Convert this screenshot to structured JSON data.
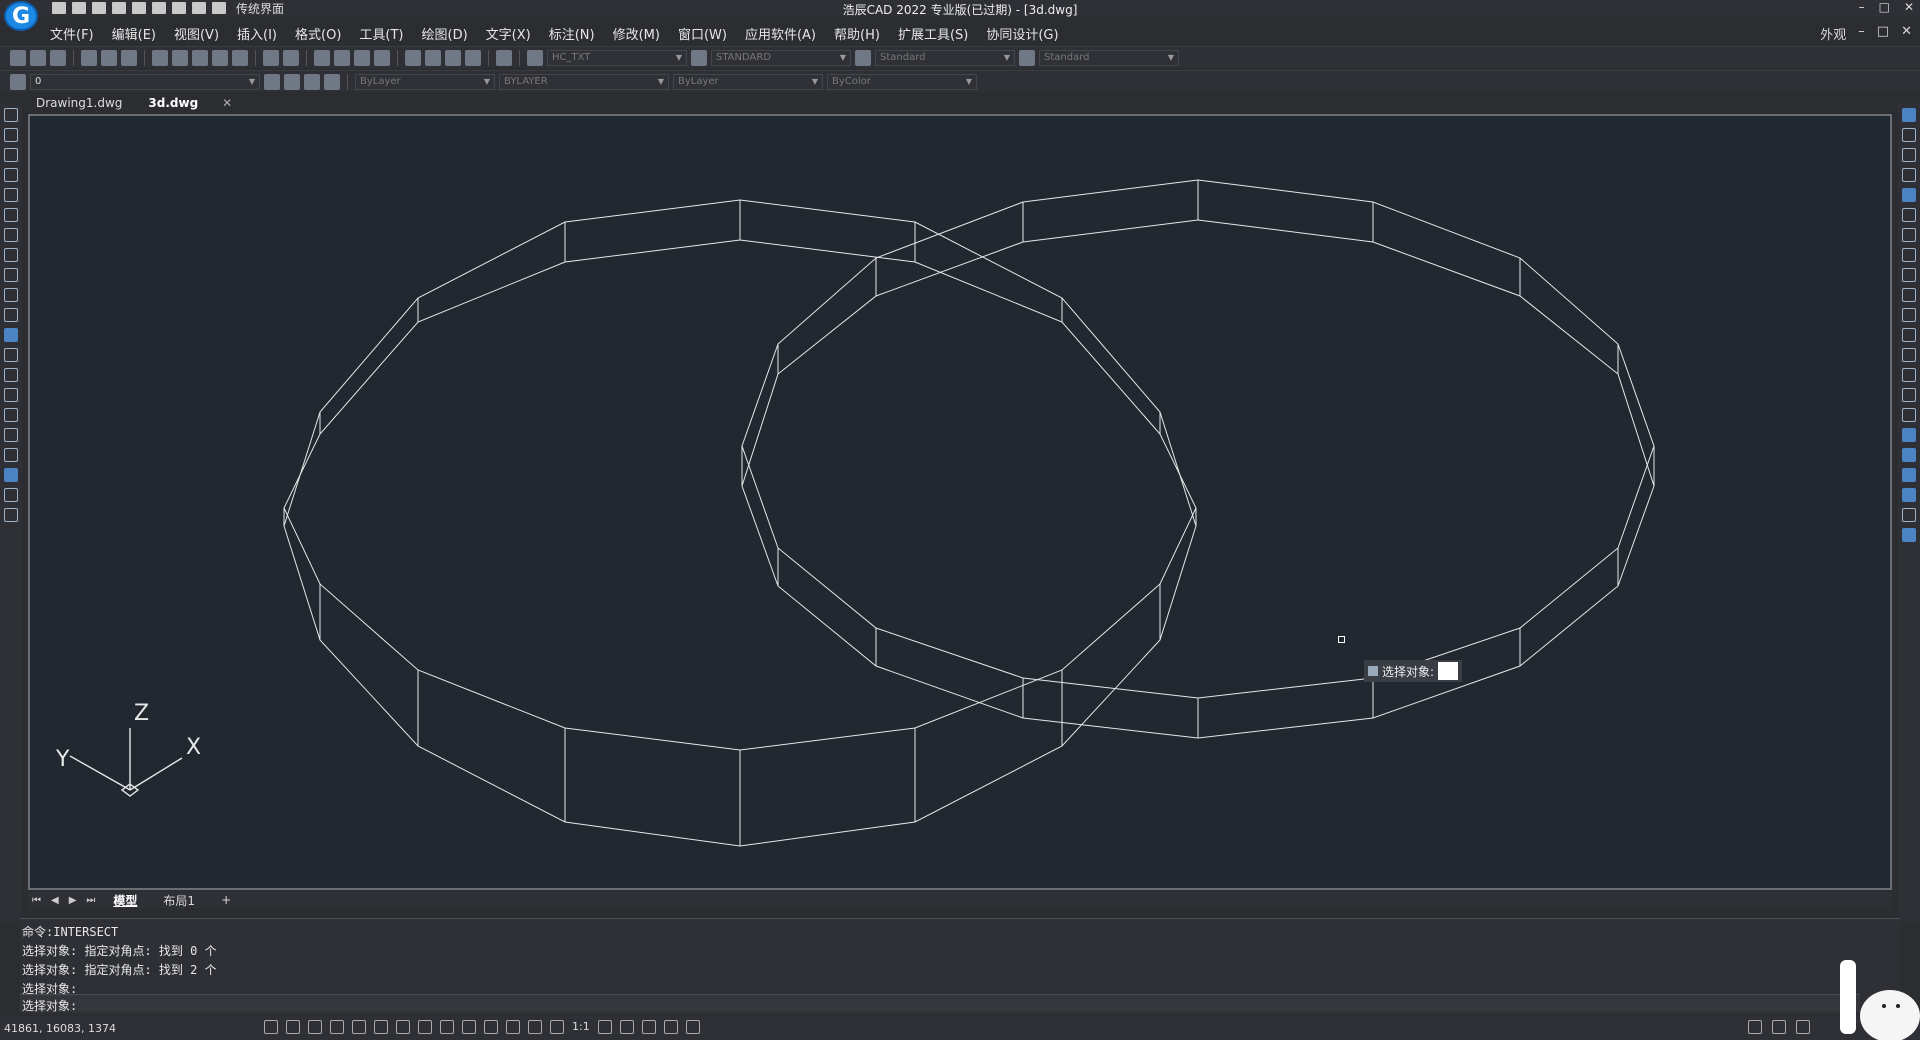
{
  "app": {
    "logo_letter": "G",
    "quick_access_label": "传统界面",
    "window_title": "浩辰CAD 2022 专业版(已过期) - [3d.dwg]",
    "window_controls": [
      "–",
      "□",
      "✕"
    ]
  },
  "menu": {
    "items": [
      "文件(F)",
      "编辑(E)",
      "视图(V)",
      "插入(I)",
      "格式(O)",
      "工具(T)",
      "绘图(D)",
      "文字(X)",
      "标注(N)",
      "修改(M)",
      "窗口(W)",
      "应用软件(A)",
      "帮助(H)",
      "扩展工具(S)",
      "协同设计(G)"
    ],
    "right": {
      "appearance": "外观",
      "controls": [
        "–",
        "□",
        "✕"
      ]
    }
  },
  "toolbar1": {
    "text_style": "HC_TXT",
    "dim_style": "STANDARD",
    "table_style": "Standard",
    "multileader_style": "Standard"
  },
  "toolbar2": {
    "layer": "0",
    "color": "ByLayer",
    "linetype": "BYLAYER",
    "lineweight": "ByLayer",
    "plotstyle": "ByColor"
  },
  "tabs": [
    {
      "label": "Drawing1.dwg",
      "active": false
    },
    {
      "label": "3d.dwg",
      "active": true
    }
  ],
  "tab_close": "✕",
  "layout_tabs": [
    {
      "label": "模型",
      "active": true
    },
    {
      "label": "布局1",
      "active": false
    }
  ],
  "layout_add": "+",
  "ucs": {
    "x": "X",
    "y": "Y",
    "z": "Z"
  },
  "tooltip": {
    "text": "选择对象:"
  },
  "command_history": [
    "命令:INTERSECT",
    "选择对象: 指定对角点: 找到 0 个",
    "选择对象: 指定对角点: 找到 2 个",
    "选择对象:"
  ],
  "command_prompt": "选择对象:",
  "status": {
    "coords": "41861, 16083, 1374",
    "scale": "1:1"
  },
  "colors": {
    "canvas_bg": "#212830",
    "wire": "#ffffff",
    "ui_bg": "#2e3036"
  }
}
